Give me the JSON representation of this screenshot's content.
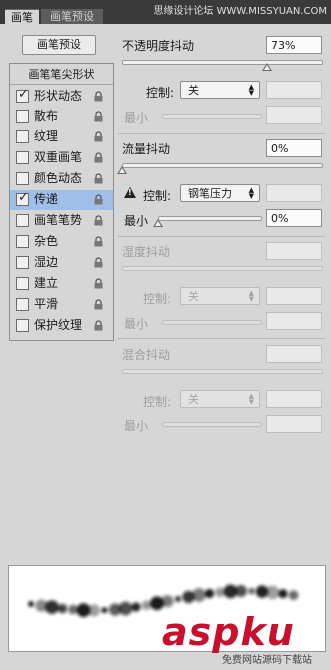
{
  "tabs": [
    {
      "label": "画笔"
    },
    {
      "label": "画笔预设"
    }
  ],
  "watermark": "思缘设计论坛 WWW.MISSYUAN.COM",
  "preset_button": "画笔预设",
  "brush_tip": "画笔笔尖形状",
  "options": [
    {
      "label": "形状动态",
      "checked": true,
      "selected": false
    },
    {
      "label": "散布",
      "checked": false,
      "selected": false
    },
    {
      "label": "纹理",
      "checked": false,
      "selected": false
    },
    {
      "label": "双重画笔",
      "checked": false,
      "selected": false
    },
    {
      "label": "颜色动态",
      "checked": false,
      "selected": false
    },
    {
      "label": "传递",
      "checked": true,
      "selected": true
    },
    {
      "label": "画笔笔势",
      "checked": false,
      "selected": false
    },
    {
      "label": "杂色",
      "checked": false,
      "selected": false
    },
    {
      "label": "湿边",
      "checked": false,
      "selected": false
    },
    {
      "label": "建立",
      "checked": false,
      "selected": false
    },
    {
      "label": "平滑",
      "checked": false,
      "selected": false
    },
    {
      "label": "保护纹理",
      "checked": false,
      "selected": false
    }
  ],
  "opacity_jitter": {
    "label": "不透明度抖动",
    "value": "73%",
    "level": 0.73
  },
  "control1": {
    "label": "控制:",
    "value": "关",
    "min_label": "最小"
  },
  "flow_jitter": {
    "label": "流量抖动",
    "value": "0%",
    "level": 0
  },
  "control2": {
    "label": "控制:",
    "value": "钢笔压力",
    "min_label": "最小",
    "min_value": "0%",
    "level": 0
  },
  "wetness_jitter": {
    "label": "湿度抖动"
  },
  "control3": {
    "label": "控制:",
    "value": "关",
    "min_label": "最小"
  },
  "mix_jitter": {
    "label": "混合抖动"
  },
  "control4": {
    "label": "控制:",
    "value": "关",
    "min_label": "最小"
  },
  "logo": "aspku",
  "logo_sub": "免费网站源码下载站",
  "colors": {
    "panel": "#d6d6d6",
    "selected": "#9fbfe8",
    "logo": "#c8102e"
  }
}
